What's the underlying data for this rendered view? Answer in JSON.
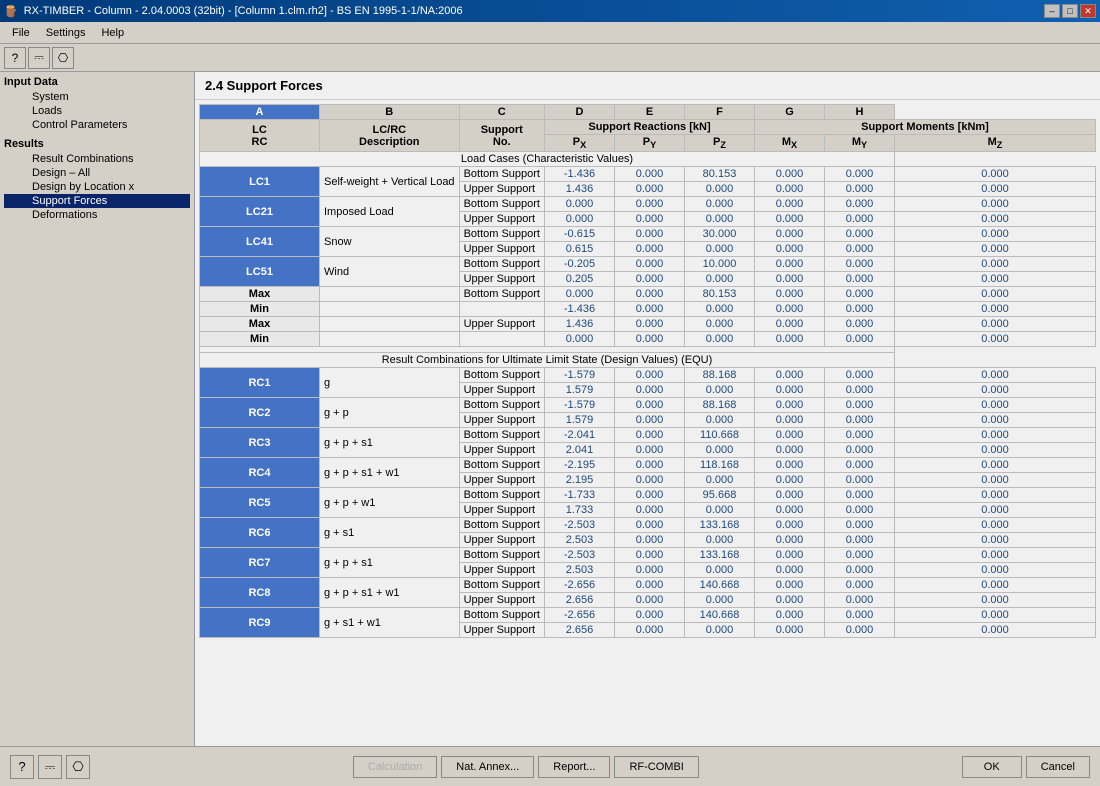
{
  "window": {
    "title": "RX-TIMBER - Column - 2.04.0003 (32bit) - [Column 1.clm.rh2] - BS EN 1995-1-1/NA:2006",
    "title_btn_minimize": "–",
    "title_btn_maximize": "□",
    "title_btn_close": "✕"
  },
  "menu": {
    "items": [
      "File",
      "Settings",
      "Help"
    ]
  },
  "sidebar": {
    "sections": [
      {
        "label": "Input Data",
        "items": [
          {
            "label": "System",
            "sub": true,
            "active": false
          },
          {
            "label": "Loads",
            "sub": true,
            "active": false
          },
          {
            "label": "Control Parameters",
            "sub": true,
            "active": false
          }
        ]
      },
      {
        "label": "Results",
        "items": [
          {
            "label": "Result Combinations",
            "sub": true,
            "active": false
          },
          {
            "label": "Design – All",
            "sub": true,
            "active": false
          },
          {
            "label": "Design by Location x",
            "sub": true,
            "active": false
          },
          {
            "label": "Support Forces",
            "sub": true,
            "active": true
          },
          {
            "label": "Deformations",
            "sub": true,
            "active": false
          }
        ]
      }
    ]
  },
  "content": {
    "title": "2.4 Support Forces",
    "columns": {
      "A": "LC/RC\nDescription",
      "B": "Support\nNo.",
      "C": "Support",
      "D": "Reactions",
      "E": "[kN]",
      "F": "Support",
      "G": "Moments",
      "H": "[kNm]"
    },
    "col_headers": [
      "A",
      "B",
      "C",
      "D",
      "E",
      "F",
      "G",
      "H"
    ],
    "sub_headers": {
      "lc_rc": "LC\nRC",
      "desc": "LC/RC\nDescription",
      "support": "Support\nNo.",
      "px": "Px",
      "py": "Py",
      "pz": "Pz",
      "mx": "Mx",
      "my": "My",
      "mz": "Mz"
    },
    "section1_label": "Load Cases (Characteristic Values)",
    "load_cases": [
      {
        "id": "LC1",
        "desc": "Self-weight + Vertical Load",
        "rows": [
          {
            "support": "Bottom Support",
            "px": "-1.436",
            "py": "0.000",
            "pz": "80.153",
            "mx": "0.000",
            "my": "0.000",
            "mz": "0.000"
          },
          {
            "support": "Upper Support",
            "px": "1.436",
            "py": "0.000",
            "pz": "0.000",
            "mx": "0.000",
            "my": "0.000",
            "mz": "0.000"
          }
        ]
      },
      {
        "id": "LC21",
        "desc": "Imposed Load",
        "rows": [
          {
            "support": "Bottom Support",
            "px": "0.000",
            "py": "0.000",
            "pz": "0.000",
            "mx": "0.000",
            "my": "0.000",
            "mz": "0.000"
          },
          {
            "support": "Upper Support",
            "px": "0.000",
            "py": "0.000",
            "pz": "0.000",
            "mx": "0.000",
            "my": "0.000",
            "mz": "0.000"
          }
        ]
      },
      {
        "id": "LC41",
        "desc": "Snow",
        "rows": [
          {
            "support": "Bottom Support",
            "px": "-0.615",
            "py": "0.000",
            "pz": "30.000",
            "mx": "0.000",
            "my": "0.000",
            "mz": "0.000"
          },
          {
            "support": "Upper Support",
            "px": "0.615",
            "py": "0.000",
            "pz": "0.000",
            "mx": "0.000",
            "my": "0.000",
            "mz": "0.000"
          }
        ]
      },
      {
        "id": "LC51",
        "desc": "Wind",
        "rows": [
          {
            "support": "Bottom Support",
            "px": "-0.205",
            "py": "0.000",
            "pz": "10.000",
            "mx": "0.000",
            "my": "0.000",
            "mz": "0.000"
          },
          {
            "support": "Upper Support",
            "px": "0.205",
            "py": "0.000",
            "pz": "0.000",
            "mx": "0.000",
            "my": "0.000",
            "mz": "0.000"
          }
        ]
      }
    ],
    "max_min_bottom": [
      {
        "type": "Max",
        "support": "Bottom Support",
        "px": "0.000",
        "py": "0.000",
        "pz": "80.153",
        "mx": "0.000",
        "my": "0.000",
        "mz": "0.000"
      },
      {
        "type": "Min",
        "support": "",
        "px": "-1.436",
        "py": "0.000",
        "pz": "0.000",
        "mx": "0.000",
        "my": "0.000",
        "mz": "0.000"
      }
    ],
    "max_min_upper": [
      {
        "type": "Max",
        "support": "Upper Support",
        "px": "1.436",
        "py": "0.000",
        "pz": "0.000",
        "mx": "0.000",
        "my": "0.000",
        "mz": "0.000"
      },
      {
        "type": "Min",
        "support": "",
        "px": "0.000",
        "py": "0.000",
        "pz": "0.000",
        "mx": "0.000",
        "my": "0.000",
        "mz": "0.000"
      }
    ],
    "section2_label": "Result Combinations for Ultimate Limit State (Design Values) (EQU)",
    "result_combinations": [
      {
        "id": "RC1",
        "desc": "g",
        "rows": [
          {
            "support": "Bottom Support",
            "px": "-1.579",
            "py": "0.000",
            "pz": "88.168",
            "mx": "0.000",
            "my": "0.000",
            "mz": "0.000"
          },
          {
            "support": "Upper Support",
            "px": "1.579",
            "py": "0.000",
            "pz": "0.000",
            "mx": "0.000",
            "my": "0.000",
            "mz": "0.000"
          }
        ]
      },
      {
        "id": "RC2",
        "desc": "g + p",
        "rows": [
          {
            "support": "Bottom Support",
            "px": "-1.579",
            "py": "0.000",
            "pz": "88.168",
            "mx": "0.000",
            "my": "0.000",
            "mz": "0.000"
          },
          {
            "support": "Upper Support",
            "px": "1.579",
            "py": "0.000",
            "pz": "0.000",
            "mx": "0.000",
            "my": "0.000",
            "mz": "0.000"
          }
        ]
      },
      {
        "id": "RC3",
        "desc": "g + p + s1",
        "rows": [
          {
            "support": "Bottom Support",
            "px": "-2.041",
            "py": "0.000",
            "pz": "110.668",
            "mx": "0.000",
            "my": "0.000",
            "mz": "0.000"
          },
          {
            "support": "Upper Support",
            "px": "2.041",
            "py": "0.000",
            "pz": "0.000",
            "mx": "0.000",
            "my": "0.000",
            "mz": "0.000"
          }
        ]
      },
      {
        "id": "RC4",
        "desc": "g + p + s1 + w1",
        "rows": [
          {
            "support": "Bottom Support",
            "px": "-2.195",
            "py": "0.000",
            "pz": "118.168",
            "mx": "0.000",
            "my": "0.000",
            "mz": "0.000"
          },
          {
            "support": "Upper Support",
            "px": "2.195",
            "py": "0.000",
            "pz": "0.000",
            "mx": "0.000",
            "my": "0.000",
            "mz": "0.000"
          }
        ]
      },
      {
        "id": "RC5",
        "desc": "g + p + w1",
        "rows": [
          {
            "support": "Bottom Support",
            "px": "-1.733",
            "py": "0.000",
            "pz": "95.668",
            "mx": "0.000",
            "my": "0.000",
            "mz": "0.000"
          },
          {
            "support": "Upper Support",
            "px": "1.733",
            "py": "0.000",
            "pz": "0.000",
            "mx": "0.000",
            "my": "0.000",
            "mz": "0.000"
          }
        ]
      },
      {
        "id": "RC6",
        "desc": "g + s1",
        "rows": [
          {
            "support": "Bottom Support",
            "px": "-2.503",
            "py": "0.000",
            "pz": "133.168",
            "mx": "0.000",
            "my": "0.000",
            "mz": "0.000"
          },
          {
            "support": "Upper Support",
            "px": "2.503",
            "py": "0.000",
            "pz": "0.000",
            "mx": "0.000",
            "my": "0.000",
            "mz": "0.000"
          }
        ]
      },
      {
        "id": "RC7",
        "desc": "g + p + s1",
        "rows": [
          {
            "support": "Bottom Support",
            "px": "-2.503",
            "py": "0.000",
            "pz": "133.168",
            "mx": "0.000",
            "my": "0.000",
            "mz": "0.000"
          },
          {
            "support": "Upper Support",
            "px": "2.503",
            "py": "0.000",
            "pz": "0.000",
            "mx": "0.000",
            "my": "0.000",
            "mz": "0.000"
          }
        ]
      },
      {
        "id": "RC8",
        "desc": "g + p + s1 + w1",
        "rows": [
          {
            "support": "Bottom Support",
            "px": "-2.656",
            "py": "0.000",
            "pz": "140.668",
            "mx": "0.000",
            "my": "0.000",
            "mz": "0.000"
          },
          {
            "support": "Upper Support",
            "px": "2.656",
            "py": "0.000",
            "pz": "0.000",
            "mx": "0.000",
            "my": "0.000",
            "mz": "0.000"
          }
        ]
      },
      {
        "id": "RC9",
        "desc": "g + s1 + w1",
        "rows": [
          {
            "support": "Bottom Support",
            "px": "-2.656",
            "py": "0.000",
            "pz": "140.668",
            "mx": "0.000",
            "my": "0.000",
            "mz": "0.000"
          },
          {
            "support": "Upper Support",
            "px": "2.656",
            "py": "0.000",
            "pz": "0.000",
            "mx": "0.000",
            "my": "0.000",
            "mz": "0.000"
          }
        ]
      }
    ]
  },
  "buttons": {
    "calculation": "Calculation",
    "nat_annex": "Nat. Annex...",
    "report": "Report...",
    "rf_combi": "RF-COMBI",
    "ok": "OK",
    "cancel": "Cancel"
  },
  "toolbar": {
    "btn1": "?",
    "btn2": "⬡",
    "btn3": "⬡"
  }
}
